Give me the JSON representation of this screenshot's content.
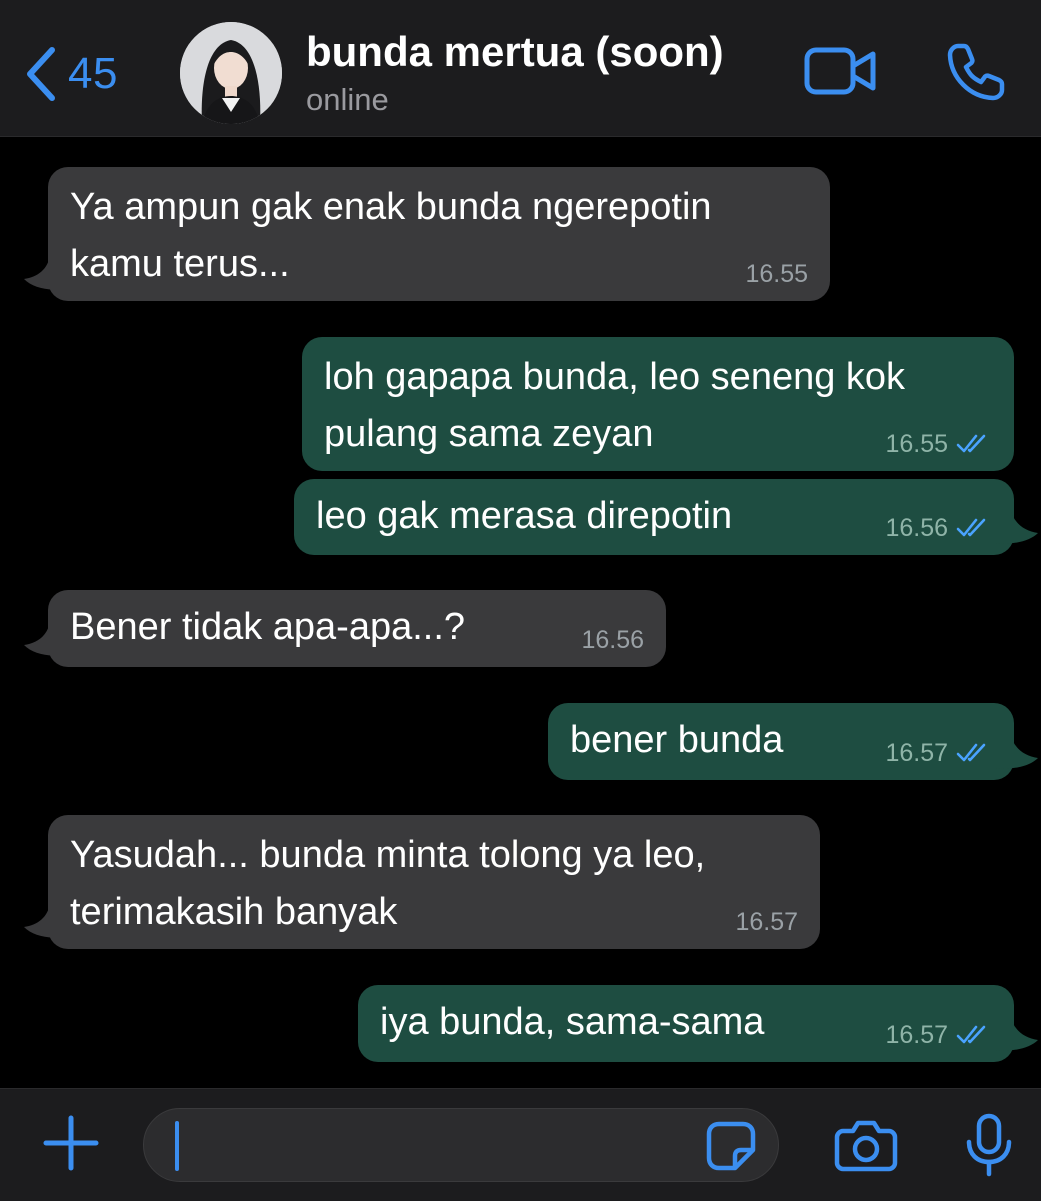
{
  "header": {
    "back_count": "45",
    "contact_name": "bunda mertua (soon)",
    "status": "online",
    "icons": {
      "back": "chevron-left-icon",
      "video": "video-call-icon",
      "call": "phone-icon"
    }
  },
  "messages": [
    {
      "direction": "incoming",
      "text": "Ya ampun gak enak bunda ngerepotin\nkamu terus...",
      "time": "16.55"
    },
    {
      "direction": "outgoing",
      "text": "loh gapapa bunda, leo seneng kok\npulang sama zeyan",
      "time": "16.55",
      "read": true
    },
    {
      "direction": "outgoing",
      "text": "leo gak merasa direpotin",
      "time": "16.56",
      "read": true
    },
    {
      "direction": "incoming",
      "text": "Bener tidak apa-apa...?",
      "time": "16.56"
    },
    {
      "direction": "outgoing",
      "text": "bener bunda",
      "time": "16.57",
      "read": true
    },
    {
      "direction": "incoming",
      "text": "Yasudah... bunda minta tolong ya leo,\nterimakasih banyak",
      "time": "16.57"
    },
    {
      "direction": "outgoing",
      "text": "iya bunda, sama-sama",
      "time": "16.57",
      "read": true
    }
  ],
  "composer": {
    "value": "",
    "icons": {
      "attach": "plus-icon",
      "sticker": "sticker-icon",
      "camera": "camera-icon",
      "mic": "microphone-icon"
    }
  },
  "colors": {
    "accent": "#3b8ef0",
    "incoming_bubble": "#3a3a3c",
    "outgoing_bubble": "#1e4d41",
    "background": "#000000",
    "bar": "#1c1c1e"
  }
}
